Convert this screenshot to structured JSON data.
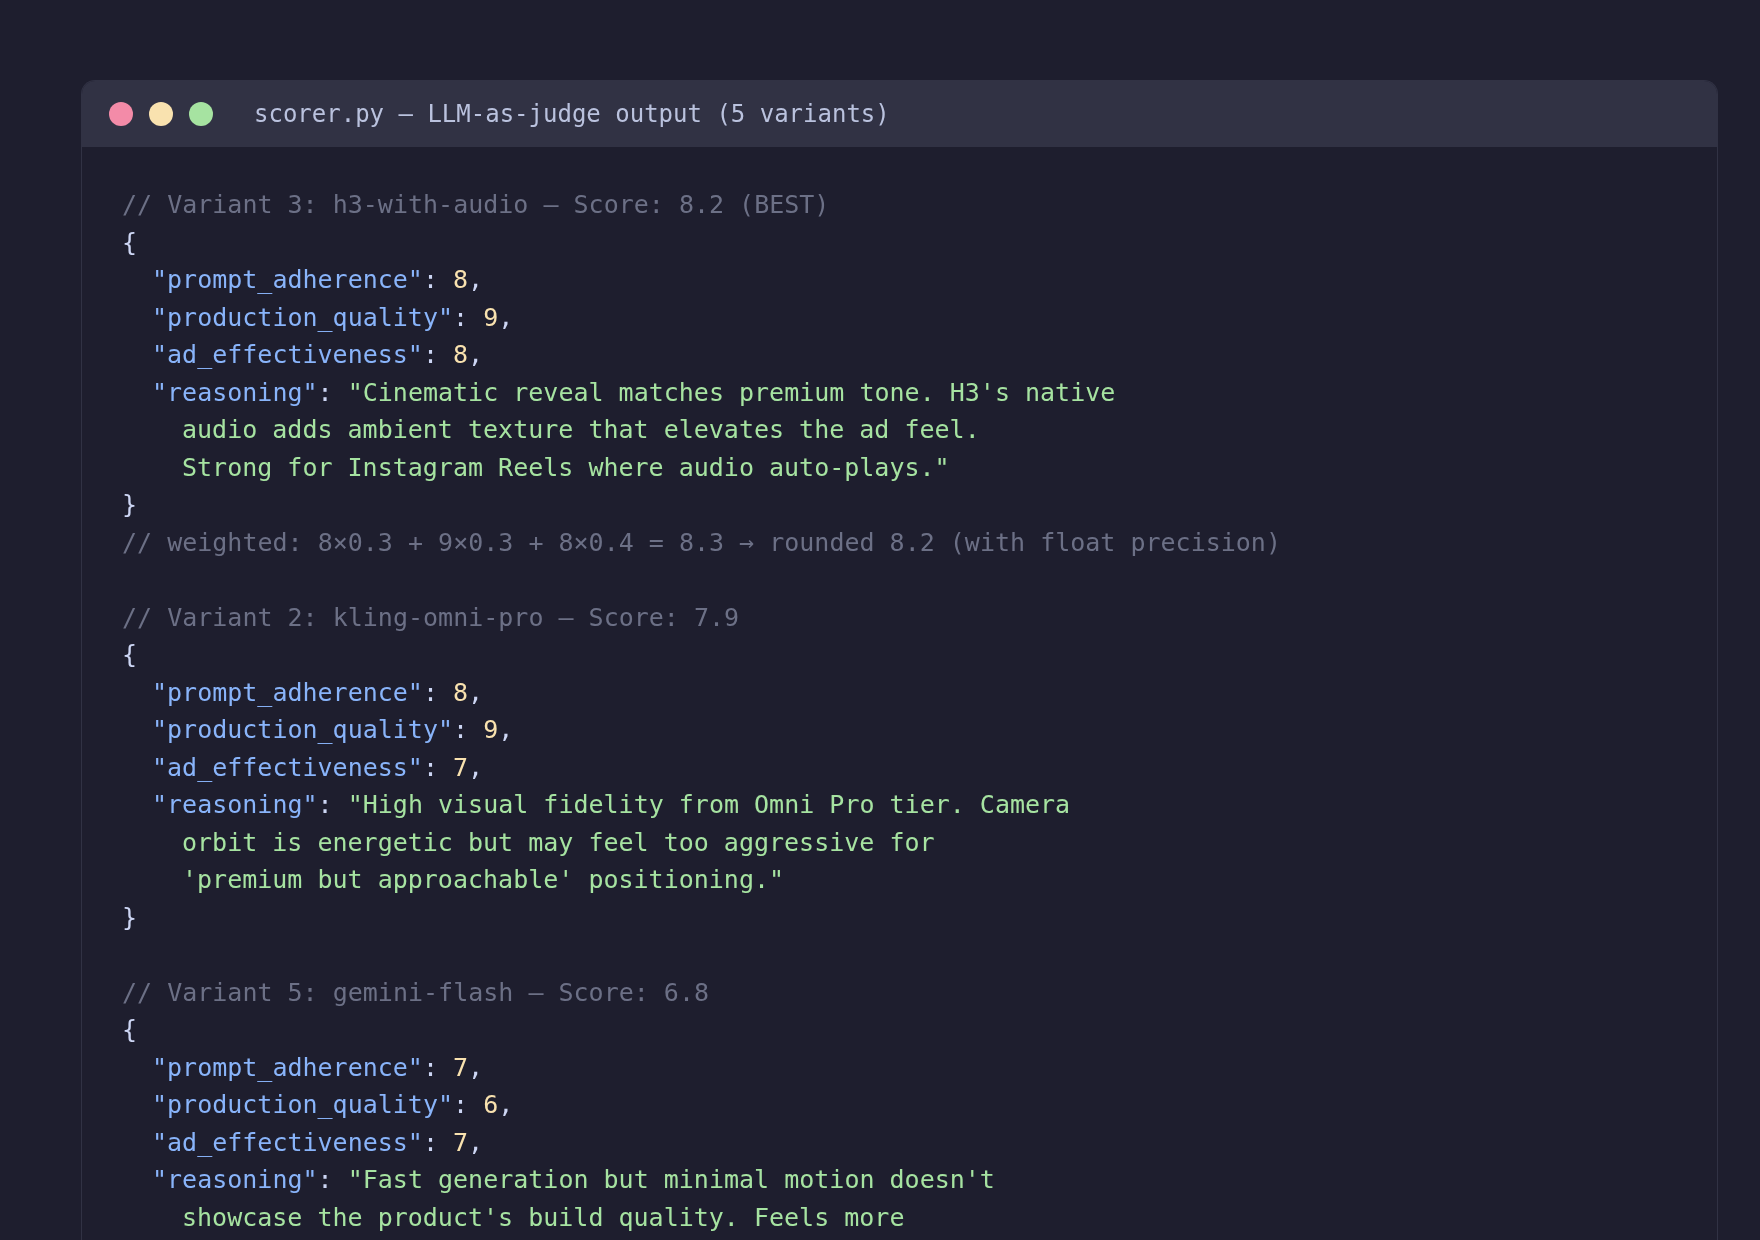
{
  "window": {
    "title": "scorer.py — LLM-as-judge output (5 variants)"
  },
  "code_lines": [
    {
      "kind": "top",
      "tokens": [
        {
          "kind": "comment",
          "text": "// Variant 3: h3-with-audio — Score: 8.2 (BEST)"
        }
      ]
    },
    {
      "kind": "top",
      "tokens": [
        {
          "kind": "punct",
          "text": "{"
        }
      ]
    },
    {
      "kind": "field",
      "tokens": [
        {
          "kind": "key",
          "text": "\"prompt_adherence\""
        },
        {
          "kind": "punct",
          "text": ": "
        },
        {
          "kind": "number",
          "text": "8"
        },
        {
          "kind": "punct",
          "text": ","
        }
      ]
    },
    {
      "kind": "field",
      "tokens": [
        {
          "kind": "key",
          "text": "\"production_quality\""
        },
        {
          "kind": "punct",
          "text": ": "
        },
        {
          "kind": "number",
          "text": "9"
        },
        {
          "kind": "punct",
          "text": ","
        }
      ]
    },
    {
      "kind": "field",
      "tokens": [
        {
          "kind": "key",
          "text": "\"ad_effectiveness\""
        },
        {
          "kind": "punct",
          "text": ": "
        },
        {
          "kind": "number",
          "text": "8"
        },
        {
          "kind": "punct",
          "text": ","
        }
      ]
    },
    {
      "kind": "field",
      "tokens": [
        {
          "kind": "key",
          "text": "\"reasoning\""
        },
        {
          "kind": "punct",
          "text": ": "
        },
        {
          "kind": "string",
          "text": "\"Cinematic reveal matches premium tone. H3's native"
        }
      ]
    },
    {
      "kind": "continuation",
      "tokens": [
        {
          "kind": "string",
          "text": "audio adds ambient texture that elevates the ad feel."
        }
      ]
    },
    {
      "kind": "continuation",
      "tokens": [
        {
          "kind": "string",
          "text": "Strong for Instagram Reels where audio auto-plays.\""
        }
      ]
    },
    {
      "kind": "top",
      "tokens": [
        {
          "kind": "punct",
          "text": "}"
        }
      ]
    },
    {
      "kind": "top",
      "tokens": [
        {
          "kind": "comment",
          "text": "// weighted: 8×0.3 + 9×0.3 + 8×0.4 = 8.3 → rounded 8.2 (with float precision)"
        }
      ]
    },
    {
      "kind": "blank"
    },
    {
      "kind": "top",
      "tokens": [
        {
          "kind": "comment",
          "text": "// Variant 2: kling-omni-pro — Score: 7.9"
        }
      ]
    },
    {
      "kind": "top",
      "tokens": [
        {
          "kind": "punct",
          "text": "{"
        }
      ]
    },
    {
      "kind": "field",
      "tokens": [
        {
          "kind": "key",
          "text": "\"prompt_adherence\""
        },
        {
          "kind": "punct",
          "text": ": "
        },
        {
          "kind": "number",
          "text": "8"
        },
        {
          "kind": "punct",
          "text": ","
        }
      ]
    },
    {
      "kind": "field",
      "tokens": [
        {
          "kind": "key",
          "text": "\"production_quality\""
        },
        {
          "kind": "punct",
          "text": ": "
        },
        {
          "kind": "number",
          "text": "9"
        },
        {
          "kind": "punct",
          "text": ","
        }
      ]
    },
    {
      "kind": "field",
      "tokens": [
        {
          "kind": "key",
          "text": "\"ad_effectiveness\""
        },
        {
          "kind": "punct",
          "text": ": "
        },
        {
          "kind": "number",
          "text": "7"
        },
        {
          "kind": "punct",
          "text": ","
        }
      ]
    },
    {
      "kind": "field",
      "tokens": [
        {
          "kind": "key",
          "text": "\"reasoning\""
        },
        {
          "kind": "punct",
          "text": ": "
        },
        {
          "kind": "string",
          "text": "\"High visual fidelity from Omni Pro tier. Camera"
        }
      ]
    },
    {
      "kind": "continuation",
      "tokens": [
        {
          "kind": "string",
          "text": "orbit is energetic but may feel too aggressive for"
        }
      ]
    },
    {
      "kind": "continuation",
      "tokens": [
        {
          "kind": "string",
          "text": "'premium but approachable' positioning.\""
        }
      ]
    },
    {
      "kind": "top",
      "tokens": [
        {
          "kind": "punct",
          "text": "}"
        }
      ]
    },
    {
      "kind": "blank"
    },
    {
      "kind": "top",
      "tokens": [
        {
          "kind": "comment",
          "text": "// Variant 5: gemini-flash — Score: 6.8"
        }
      ]
    },
    {
      "kind": "top",
      "tokens": [
        {
          "kind": "punct",
          "text": "{"
        }
      ]
    },
    {
      "kind": "field",
      "tokens": [
        {
          "kind": "key",
          "text": "\"prompt_adherence\""
        },
        {
          "kind": "punct",
          "text": ": "
        },
        {
          "kind": "number",
          "text": "7"
        },
        {
          "kind": "punct",
          "text": ","
        }
      ]
    },
    {
      "kind": "field",
      "tokens": [
        {
          "kind": "key",
          "text": "\"production_quality\""
        },
        {
          "kind": "punct",
          "text": ": "
        },
        {
          "kind": "number",
          "text": "6"
        },
        {
          "kind": "punct",
          "text": ","
        }
      ]
    },
    {
      "kind": "field",
      "tokens": [
        {
          "kind": "key",
          "text": "\"ad_effectiveness\""
        },
        {
          "kind": "punct",
          "text": ": "
        },
        {
          "kind": "number",
          "text": "7"
        },
        {
          "kind": "punct",
          "text": ","
        }
      ]
    },
    {
      "kind": "field",
      "tokens": [
        {
          "kind": "key",
          "text": "\"reasoning\""
        },
        {
          "kind": "punct",
          "text": ": "
        },
        {
          "kind": "string",
          "text": "\"Fast generation but minimal motion doesn't"
        }
      ]
    },
    {
      "kind": "continuation",
      "tokens": [
        {
          "kind": "string",
          "text": "showcase the product's build quality. Feels more"
        }
      ]
    }
  ]
}
